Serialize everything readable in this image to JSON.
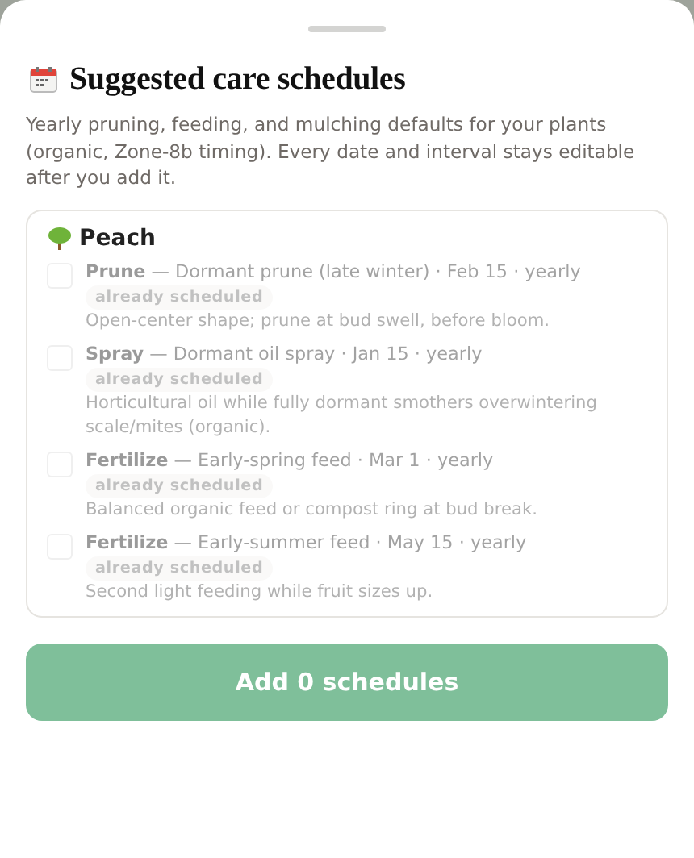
{
  "sheet": {
    "title": "Suggested care schedules",
    "description": "Yearly pruning, feeding, and mulching defaults for your plants (organic, Zone-8b timing). Every date and interval stays editable after you add it.",
    "plant": {
      "name": "Peach",
      "schedules": [
        {
          "summary": "**Prune** — Dormant prune (late winter) · Feb 15 · yearly",
          "badge": "already scheduled",
          "note": "Open-center shape; prune at bud swell, before bloom.",
          "checked": false,
          "disabled": true
        },
        {
          "summary": "**Spray** — Dormant oil spray · Jan 15 · yearly",
          "badge": "already scheduled",
          "note": "Horticultural oil while fully dormant smothers overwintering scale/mites (organic).",
          "checked": false,
          "disabled": true
        },
        {
          "summary": "**Fertilize** — Early-spring feed · Mar 1 · yearly",
          "badge": "already scheduled",
          "note": "Balanced organic feed or compost ring at bud break.",
          "checked": false,
          "disabled": true
        },
        {
          "summary": "**Fertilize** — Early-summer feed · May 15 · yearly",
          "badge": "already scheduled",
          "note": "Second light feeding while fruit sizes up.",
          "checked": false,
          "disabled": true
        }
      ]
    },
    "add_button": {
      "label": "Add 0 schedules",
      "disabled": true
    }
  }
}
